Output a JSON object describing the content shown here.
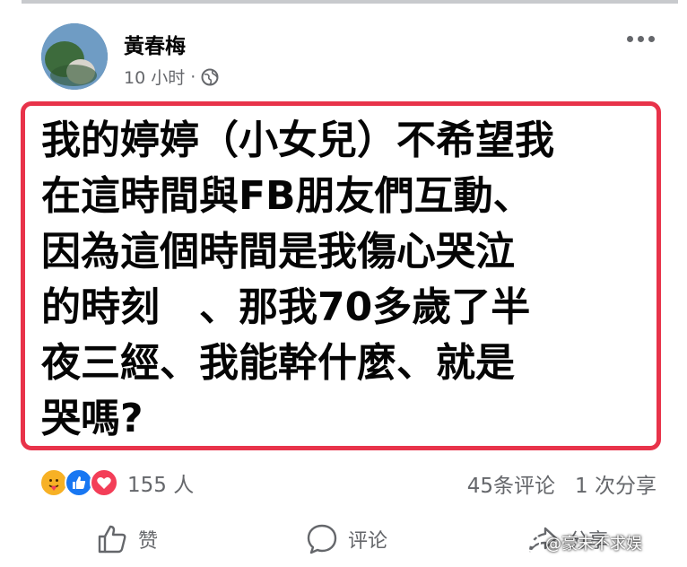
{
  "post": {
    "author": "黃春梅",
    "time": "10 小时",
    "separator": "·",
    "text": "我的婷婷（小女兒）不希望我\n在這時間與FB朋友們互動、\n因為這個時間是我傷心哭泣\n的時刻　、那我70多歲了半\n夜三經、我能幹什麼、就是\n哭嗎?"
  },
  "reactions": {
    "count": "155 人",
    "icons": [
      "care-icon",
      "like-icon",
      "love-icon"
    ]
  },
  "stats": {
    "comments": "45条评论",
    "shares": "1 次分享"
  },
  "actions": {
    "like": "赞",
    "comment": "评论",
    "share": "分享"
  },
  "watermark": {
    "text": "@豪末不求娱"
  }
}
